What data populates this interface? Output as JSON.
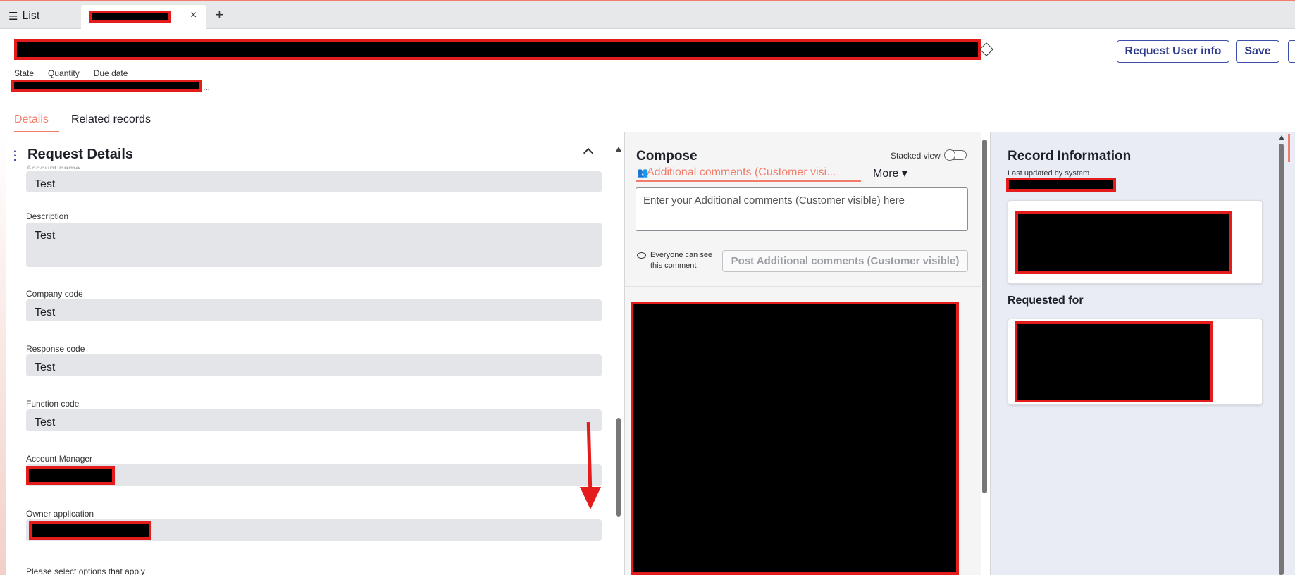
{
  "tabbar": {
    "list_label": "List",
    "list_icon": "list-icon",
    "active_tab_close": "×",
    "add_tab": "+"
  },
  "header": {
    "buttons": {
      "request_user_info": "Request User info",
      "save": "Save"
    },
    "meta_labels": {
      "state": "State",
      "quantity": "Quantity",
      "due_date": "Due date"
    },
    "meta_ellipsis": "..."
  },
  "tabs": {
    "details": "Details",
    "related_records": "Related records"
  },
  "details": {
    "section_title": "Request Details",
    "cut_top_label": "Account name",
    "fields": [
      {
        "label": "",
        "value": "Test"
      },
      {
        "label": "Description",
        "value": "Test"
      },
      {
        "label": "Company code",
        "value": "Test"
      },
      {
        "label": "Response code",
        "value": "Test"
      },
      {
        "label": "Function code",
        "value": "Test"
      },
      {
        "label": "Account Manager",
        "value": ""
      },
      {
        "label": "Owner application",
        "value": ""
      }
    ],
    "cut_bottom_label": "Please select options that apply"
  },
  "compose": {
    "title": "Compose",
    "stacked_view": "Stacked view",
    "active_tab": "Additional comments (Customer visi...",
    "more": "More ▾",
    "textarea_placeholder": "Enter your Additional comments (Customer visible) here",
    "visibility_note": "Everyone can see this comment",
    "post_button": "Post Additional comments (Customer visible)"
  },
  "record_info": {
    "title": "Record Information",
    "last_updated": "Last updated by system",
    "requested_for": "Requested for"
  },
  "colors": {
    "accent": "#f27d6b",
    "primary": "#2d3a8c",
    "redaction": "#e41c1c"
  }
}
